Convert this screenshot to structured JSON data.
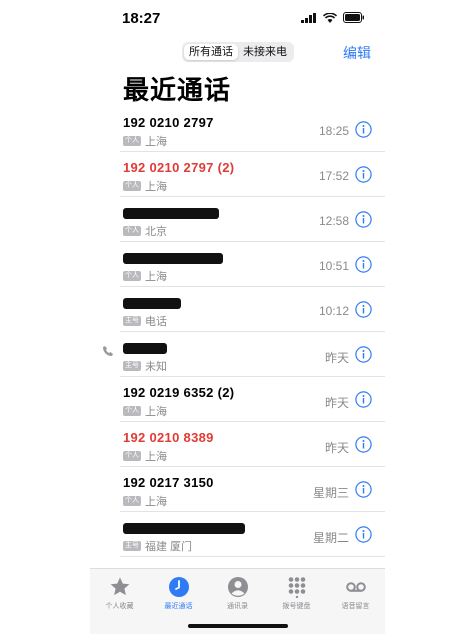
{
  "status": {
    "time": "18:27"
  },
  "segment": {
    "options": [
      "所有通话",
      "未接来电"
    ]
  },
  "header": {
    "edit_label": "编辑",
    "title": "最近通话"
  },
  "calls": [
    {
      "number": "192 0210 2797",
      "missed": false,
      "sim": "个人",
      "location": "上海",
      "time": "18:25"
    },
    {
      "number": "192 0210 2797 (2)",
      "missed": true,
      "sim": "个人",
      "location": "上海",
      "time": "17:52"
    },
    {
      "number": "",
      "missed": false,
      "sim": "个人",
      "location": "北京",
      "time": "12:58"
    },
    {
      "number": "",
      "missed": false,
      "sim": "个人",
      "location": "上海",
      "time": "10:51"
    },
    {
      "number": "",
      "missed": false,
      "sim": "主号",
      "location": "电话",
      "time": "10:12"
    },
    {
      "number": "",
      "missed": false,
      "sim": "主号",
      "location": "未知",
      "time": "昨天"
    },
    {
      "number": "192 0219 6352 (2)",
      "missed": false,
      "sim": "个人",
      "location": "上海",
      "time": "昨天"
    },
    {
      "number": "192 0210 8389",
      "missed": true,
      "sim": "个人",
      "location": "上海",
      "time": "昨天"
    },
    {
      "number": "192 0217 3150",
      "missed": false,
      "sim": "个人",
      "location": "上海",
      "time": "星期三"
    },
    {
      "number": "",
      "missed": false,
      "sim": "主号",
      "location": "福建 厦门",
      "time": "星期二"
    }
  ],
  "tabs": [
    {
      "label": "个人收藏",
      "icon": "star-icon"
    },
    {
      "label": "最近通话",
      "icon": "clock-icon"
    },
    {
      "label": "通讯录",
      "icon": "person-icon"
    },
    {
      "label": "拨号键盘",
      "icon": "keypad-icon"
    },
    {
      "label": "语音留言",
      "icon": "voicemail-icon"
    }
  ],
  "colors": {
    "accent": "#2f7bf6",
    "missed": "#e03b36",
    "secondary": "#8a8a8e"
  }
}
